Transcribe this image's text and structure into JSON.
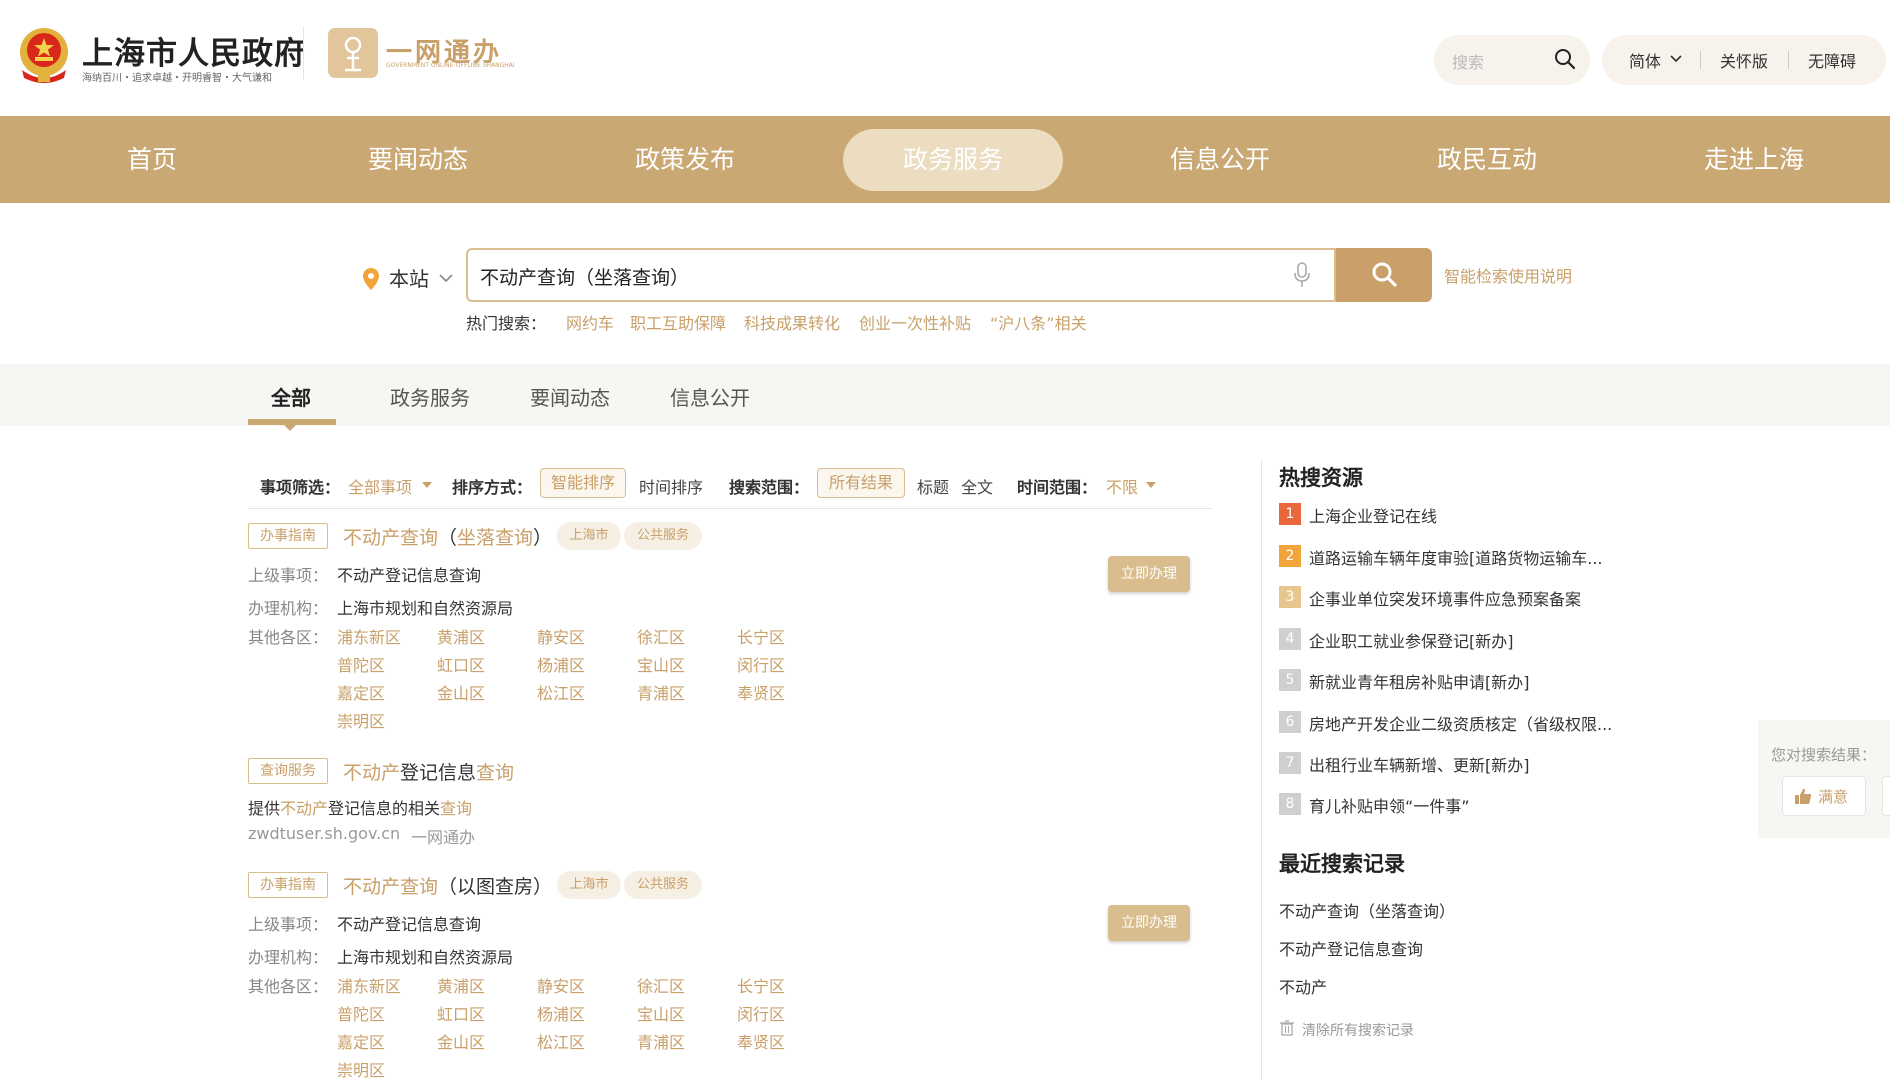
{
  "header": {
    "site_title": "上海市人民政府",
    "site_slogan": "海纳百川・追求卓越・开明睿智・大气谦和",
    "service_logo_text": "一网通办",
    "service_logo_sub": "GOVERNMENT ONLINE-OFFLINE SHANGHAI",
    "search_placeholder": "搜索",
    "language": "简体",
    "care_mode": "关怀版",
    "accessibility": "无障碍"
  },
  "nav": {
    "items": [
      "首页",
      "要闻动态",
      "政策发布",
      "政务服务",
      "信息公开",
      "政民互动",
      "走进上海"
    ],
    "active": "政务服务"
  },
  "search": {
    "scope": "本站",
    "query": "不动产查询（坐落查询）",
    "help_link": "智能检索使用说明",
    "hot_label": "热门搜索：",
    "hot_terms": [
      "网约车",
      "职工互助保障",
      "科技成果转化",
      "创业一次性补贴",
      "“沪八条”相关"
    ]
  },
  "tabs": {
    "items": [
      "全部",
      "政务服务",
      "要闻动态",
      "信息公开"
    ],
    "active": "全部"
  },
  "filters": {
    "item_label": "事项筛选：",
    "item_value": "全部事项",
    "sort_label": "排序方式：",
    "sort_options": [
      "智能排序",
      "时间排序"
    ],
    "scope_label": "搜索范围：",
    "scope_options": [
      "所有结果",
      "标题",
      "全文"
    ],
    "time_label": "时间范围：",
    "time_value": "不限"
  },
  "results": [
    {
      "tag": "办事指南",
      "title_hl1": "不动产查询",
      "title_mid": "（",
      "title_hl2": "坐落查询",
      "title_end": "）",
      "chips": [
        "上海市",
        "公共服务"
      ],
      "parent_label": "上级事项：",
      "parent_value": "不动产登记信息查询",
      "org_label": "办理机构：",
      "org_value": "上海市规划和自然资源局",
      "districts_label": "其他各区：",
      "districts": [
        "浦东新区",
        "黄浦区",
        "静安区",
        "徐汇区",
        "长宁区",
        "普陀区",
        "虹口区",
        "杨浦区",
        "宝山区",
        "闵行区",
        "嘉定区",
        "金山区",
        "松江区",
        "青浦区",
        "奉贤区",
        "崇明区"
      ],
      "action": "立即办理"
    },
    {
      "tag": "查询服务",
      "title_hl1": "不动产",
      "title_mid": "登记信息",
      "title_hl2": "查询",
      "desc_pre": "提供",
      "desc_hl1": "不动产",
      "desc_mid": "登记信息的相关",
      "desc_hl2": "查询",
      "source_url": "zwdtuser.sh.gov.cn",
      "source_name": "一网通办"
    },
    {
      "tag": "办事指南",
      "title_hl1": "不动产查询",
      "title_rest": "（以图查房）",
      "chips": [
        "上海市",
        "公共服务"
      ],
      "parent_label": "上级事项：",
      "parent_value": "不动产登记信息查询",
      "org_label": "办理机构：",
      "org_value": "上海市规划和自然资源局",
      "districts_label": "其他各区：",
      "districts": [
        "浦东新区",
        "黄浦区",
        "静安区",
        "徐汇区",
        "长宁区",
        "普陀区",
        "虹口区",
        "杨浦区",
        "宝山区",
        "闵行区",
        "嘉定区",
        "金山区",
        "松江区",
        "青浦区",
        "奉贤区",
        "崇明区"
      ],
      "action": "立即办理"
    }
  ],
  "sidebar": {
    "hot_title": "热搜资源",
    "hot_items": [
      "上海企业登记在线",
      "道路运输车辆年度审验[道路货物运输车...",
      "企事业单位突发环境事件应急预案备案",
      "企业职工就业参保登记[新办]",
      "新就业青年租房补贴申请[新办]",
      "房地产开发企业二级资质核定（省级权限...",
      "出租行业车辆新增、更新[新办]",
      "育儿补贴申领“一件事”"
    ],
    "rank_numbers": [
      "1",
      "2",
      "3",
      "4",
      "5",
      "6",
      "7",
      "8"
    ],
    "rank_colors": [
      "#e8673b",
      "#f0a43a",
      "#e8c78e",
      "#cfcfcf",
      "#cfcfcf",
      "#cfcfcf",
      "#cfcfcf",
      "#cfcfcf"
    ],
    "recent_title": "最近搜索记录",
    "recent_items": [
      "不动产查询（坐落查询）",
      "不动产登记信息查询",
      "不动产"
    ],
    "clear_label": "清除所有搜索记录"
  },
  "feedback": {
    "question": "您对搜索结果：",
    "satisfied": "满意"
  },
  "colors": {
    "brand_gold": "#c9a873",
    "accent": "#c9a06a",
    "nav_active": "#ecdcc0"
  }
}
